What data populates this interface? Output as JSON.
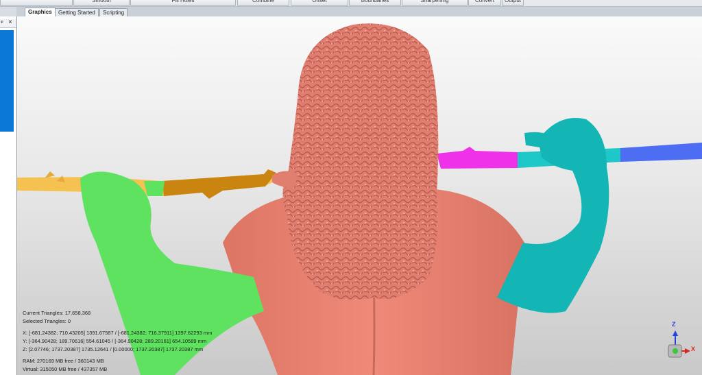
{
  "ribbon": {
    "buttons": [
      "Smooth",
      "Fill Holes",
      "Combine",
      "Offset",
      "Boundaries",
      "Sharpening",
      "Convert",
      "Output"
    ]
  },
  "tabs": [
    "Graphics",
    "Getting Started",
    "Scripting"
  ],
  "side_panel": {
    "pin_glyph": "ᵠ",
    "close_glyph": "×"
  },
  "info": {
    "current_triangles": "Current Triangles: 17,658,368",
    "selected_triangles": "Selected Triangles: 0",
    "x_range": "X:  [-681.24382; 710.43205] 1391.67587 / [-681.24382; 716.37911] 1397.62293 mm",
    "y_range": "Y:  [-364.90428; 189.70616] 554.61045 / [-364.90428; 289.20161] 654.10589 mm",
    "z_range": "Z:  [2.07746; 1737.20387] 1735.12641 / [0.00000; 1737.20387] 1737.20387 mm",
    "ram": "RAM: 270169 MB free / 360143 MB",
    "virtual": "Virtual: 315050 MB free / 437357 MB"
  },
  "axes": {
    "z": "Z",
    "x": "X"
  },
  "colors": {
    "stick_yellow": "#f5c150",
    "stick_orange": "#c9850f",
    "stick_magenta": "#ef32ea",
    "stick_teal": "#1fc8c8",
    "stick_blue": "#4d6ef2",
    "body_salmon": "#e98372",
    "left_arm_green": "#5fe260",
    "right_arm_cyan": "#13b5b5",
    "tab_blue": "#0a78d7"
  }
}
